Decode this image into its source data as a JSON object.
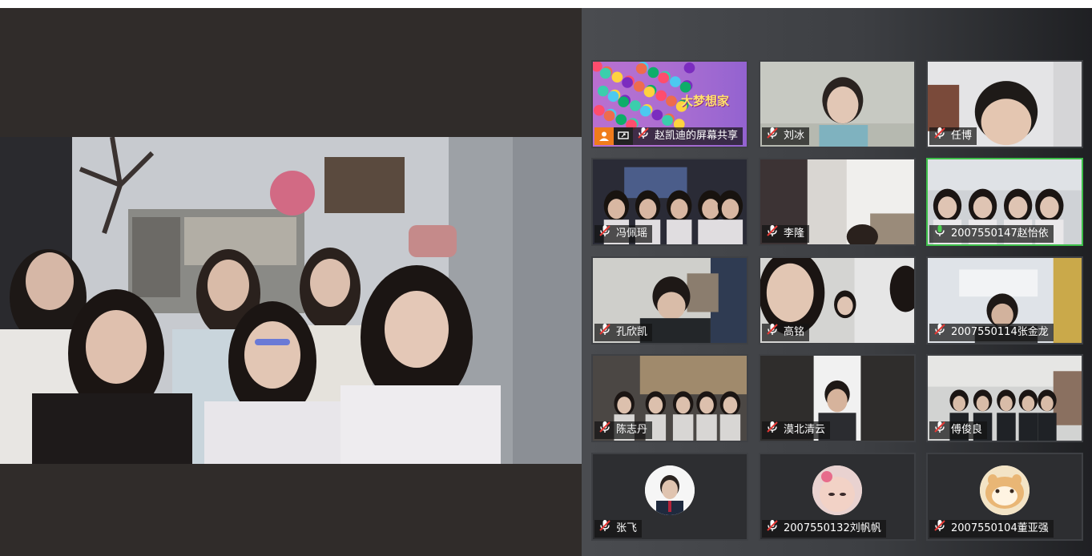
{
  "main_speaker": {
    "name": "2007550147赵怡依"
  },
  "participants": [
    {
      "name": "赵凯迪的屏幕共享",
      "muted": true,
      "kind": "screen-share",
      "banner_text": "大梦想家"
    },
    {
      "name": "刘冰",
      "muted": true,
      "kind": "video"
    },
    {
      "name": "任博",
      "muted": true,
      "kind": "video"
    },
    {
      "name": "冯佩瑶",
      "muted": true,
      "kind": "video"
    },
    {
      "name": "李隆",
      "muted": true,
      "kind": "video"
    },
    {
      "name": "2007550147赵怡依",
      "muted": false,
      "kind": "video",
      "active": true
    },
    {
      "name": "孔欣凯",
      "muted": true,
      "kind": "video"
    },
    {
      "name": "高铭",
      "muted": true,
      "kind": "video"
    },
    {
      "name": "2007550114张金龙",
      "muted": true,
      "kind": "video"
    },
    {
      "name": "陈志丹",
      "muted": true,
      "kind": "video"
    },
    {
      "name": "漠北清云",
      "muted": true,
      "kind": "video"
    },
    {
      "name": "傅俊良",
      "muted": true,
      "kind": "video"
    },
    {
      "name": "张飞",
      "muted": true,
      "kind": "avatar"
    },
    {
      "name": "2007550132刘帆帆",
      "muted": true,
      "kind": "avatar"
    },
    {
      "name": "2007550104董亚强",
      "muted": true,
      "kind": "avatar"
    }
  ],
  "colors": {
    "active_border": "#3dbf4a",
    "share_badge": "#f07c1b",
    "mic_muted": "#e53935",
    "mic_live": "#ffffff"
  },
  "icons": {
    "muted": "mic-muted-icon",
    "live": "mic-on-icon",
    "share": "screen-share-icon",
    "person": "person-icon"
  }
}
